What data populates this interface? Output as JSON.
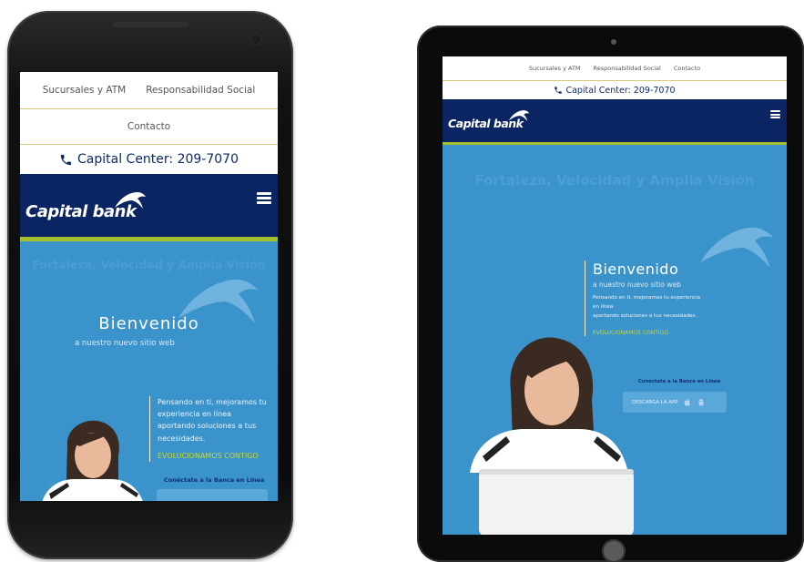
{
  "nav": {
    "branches": "Sucursales y ATM",
    "social": "Responsabilidad Social",
    "contact": "Contacto"
  },
  "phone_line": "Capital Center: 209-7070",
  "brand": {
    "name": "Capital bank"
  },
  "hero": {
    "tagline": "Fortaleza, Velocidad y Amplia Visión",
    "welcome": "Bienvenido",
    "subtitle": "a nuestro nuevo sitio web",
    "description_mobile": "Pensando en ti, mejoramos tu experiencia en línea aportando soluciones a tus necesidades.",
    "description_tablet_1": "Pensando en ti, mejoramos tu experiencia",
    "description_tablet_2": "en línea",
    "description_tablet_3": "aportando soluciones a tus necesidades.",
    "slogan": "EVOLUCIONAMOS CONTIGO",
    "connect": "Conéctate a la Banca en Línea",
    "download": "DESCARGA LA APP"
  },
  "colors": {
    "navy": "#0b2563",
    "accent_green": "#a6bd2d",
    "hero_blue": "#3b93cb",
    "slogan_green": "#c3d83c"
  }
}
